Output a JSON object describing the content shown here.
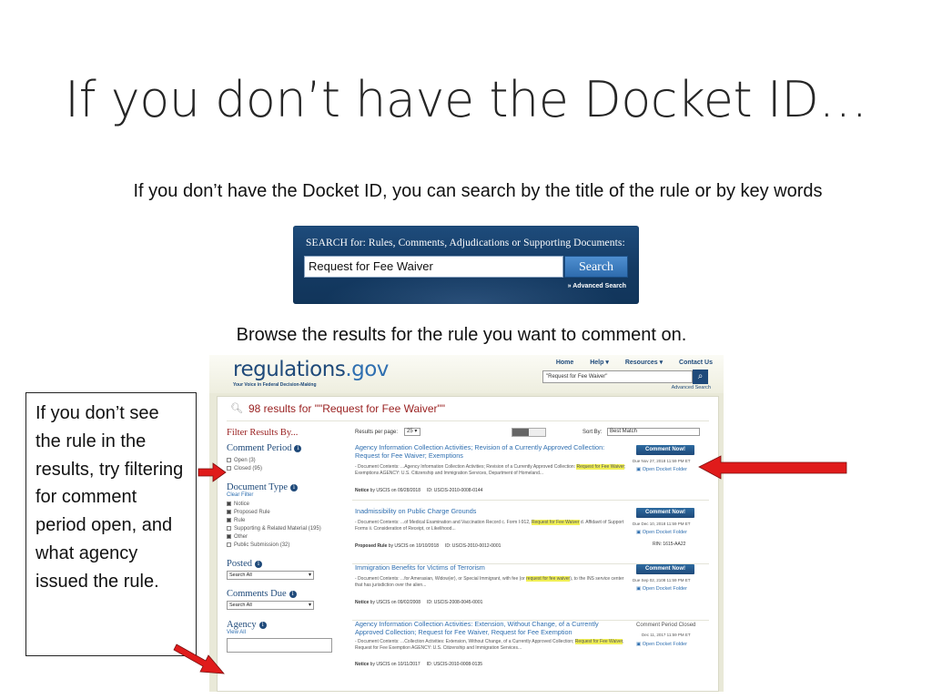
{
  "slide": {
    "title": "If you don’t have the Docket ID…",
    "subtitle": "If you don’t have the Docket ID, you can search by the title of the rule or by key words",
    "browse_text": "Browse the results for the rule you want to comment on.",
    "callout_text": "If you don’t see the rule in the results, try filtering for comment period open, and what agency issued the rule."
  },
  "search_box": {
    "label": "SEARCH for: Rules, Comments, Adjudications or Supporting Documents:",
    "value": "Request for Fee Waiver",
    "button": "Search",
    "advanced": "» Advanced Search"
  },
  "site": {
    "logo_main": "regulations",
    "logo_gov": ".gov",
    "tagline": "Your Voice in Federal Decision-Making",
    "nav": [
      "Home",
      "Help ▾",
      "Resources ▾",
      "Contact Us"
    ],
    "search_value": "\"Request for Fee Waiver\"",
    "advanced": "Advanced Search",
    "results_title": "98 results for \"\"Request for Fee Waiver\"\"",
    "filter_heading": "Filter Results By...",
    "comment_period": {
      "label": "Comment Period",
      "open": "Open (3)",
      "closed": "Closed (95)"
    },
    "document_type": {
      "label": "Document Type",
      "clear": "Clear Filter",
      "items": [
        "Notice",
        "Proposed Rule",
        "Rule",
        "Supporting & Related Material (195)",
        "Other",
        "Public Submission (32)"
      ]
    },
    "posted": {
      "label": "Posted",
      "value": "Search All"
    },
    "comments_due": {
      "label": "Comments Due",
      "value": "Search All"
    },
    "agency": {
      "label": "Agency",
      "view_all": "View All"
    },
    "toolbar": {
      "rpp_label": "Results per page:",
      "rpp_value": "25 ▾",
      "sort_label": "Sort By:",
      "sort_value": "Best Match"
    },
    "results": [
      {
        "title": "Agency Information Collection Activities; Revision of a Currently Approved Collection: Request for Fee Waiver; Exemptions",
        "desc_pre": "- Document Contents: ...Agency Information Collection Activities; Revision of a Currently Approved Collection:",
        "desc_hl": "Request for Fee Waiver",
        "desc_post": "; Exemptions AGENCY: U.S. Citizenship and Immigration Services, Department of Homeland...",
        "meta_type": "Notice",
        "meta_rest": "by USCIS on 09/28/2018",
        "meta_id": "ID: USCIS-2010-0008-0144",
        "button": "Comment Now!",
        "due": "Due Nov 27, 2018 11:59 PM ET",
        "folder": "Open Docket Folder"
      },
      {
        "title": "Inadmissibility on Public Charge Grounds",
        "desc_pre": "- Document Contents: ...of Medical Examination and Vaccination Record c. Form I-912,",
        "desc_hl": "Request for Fee Waiver",
        "desc_post": "d. Affidavit of Support Forms ii. Consideration of Receipt, or Likelihood...",
        "meta_type": "Proposed Rule",
        "meta_rest": "by USCIS on 10/10/2018",
        "meta_id": "ID: USCIS-2010-0012-0001",
        "button": "Comment Now!",
        "due": "Due Dec 10, 2018 11:59 PM ET",
        "folder": "Open Docket Folder",
        "rin": "RIN: 1615-AA22"
      },
      {
        "title": "Immigration Benefits for Victims of Terrorism",
        "desc_pre": "- Document Contents: ...for Amerasian, Widow(er), or Special Immigrant, with fee (or",
        "desc_hl": "request for fee waiver",
        "desc_post": "), to the INS service center that has jurisdiction over the alien...",
        "meta_type": "Notice",
        "meta_rest": "by USCIS on 09/02/2008",
        "meta_id": "ID: USCIS-2008-0045-0001",
        "button": "Comment Now!",
        "due": "Due Sep 02, 2108 11:59 PM ET",
        "folder": "Open Docket Folder"
      },
      {
        "title": "Agency Information Collection Activities: Extension, Without Change, of a Currently Approved Collection; Request for Fee Waiver, Request for Fee Exemption",
        "desc_pre": "- Document Contents: ...Collection Activities: Extension, Without Change, of a Currently Approved Collection;",
        "desc_hl": "Request for Fee Waiver",
        "desc_post": ", Request for Fee Exemption AGENCY: U.S. Citizenship and Immigration Services...",
        "meta_type": "Notice",
        "meta_rest": "by USCIS on 10/11/2017",
        "meta_id": "ID: USCIS-2010-0008-0135",
        "closed": "Comment Period Closed",
        "due": "Dec 11, 2017 11:59 PM ET",
        "folder": "Open Docket Folder"
      }
    ]
  },
  "colors": {
    "arrow": "#e01b1b",
    "brand": "#1f4a7a",
    "result_title": "#9a2222"
  }
}
